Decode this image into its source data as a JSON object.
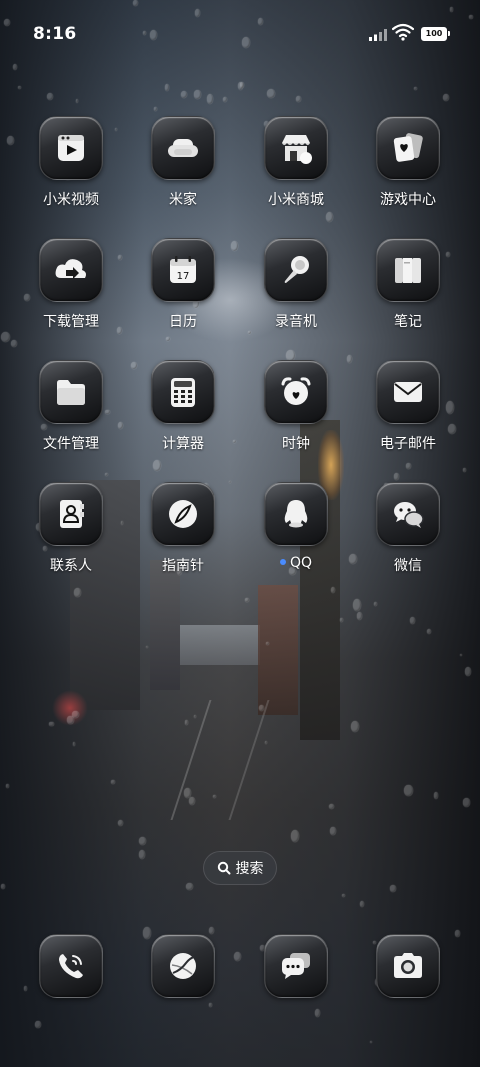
{
  "status_bar": {
    "time": "8:16",
    "battery": "100",
    "icons": [
      "signal-icon",
      "wifi-icon",
      "battery-icon"
    ]
  },
  "apps": [
    {
      "label": "小米视频",
      "icon": "video-player-icon"
    },
    {
      "label": "米家",
      "icon": "sofa-icon"
    },
    {
      "label": "小米商城",
      "icon": "store-icon"
    },
    {
      "label": "游戏中心",
      "icon": "playing-cards-icon"
    },
    {
      "label": "下载管理",
      "icon": "download-cloud-icon"
    },
    {
      "label": "日历",
      "icon": "calendar-icon",
      "badge_text": "17"
    },
    {
      "label": "录音机",
      "icon": "microphone-icon"
    },
    {
      "label": "笔记",
      "icon": "notebook-icon"
    },
    {
      "label": "文件管理",
      "icon": "folder-icon"
    },
    {
      "label": "计算器",
      "icon": "calculator-icon"
    },
    {
      "label": "时钟",
      "icon": "alarm-clock-icon"
    },
    {
      "label": "电子邮件",
      "icon": "envelope-icon"
    },
    {
      "label": "联系人",
      "icon": "contact-book-icon"
    },
    {
      "label": "指南针",
      "icon": "compass-icon"
    },
    {
      "label": "QQ",
      "icon": "penguin-icon",
      "new_dot": true
    },
    {
      "label": "微信",
      "icon": "chat-bubbles-icon"
    }
  ],
  "search": {
    "label": "搜索",
    "icon": "search-icon"
  },
  "dock": [
    {
      "name": "phone",
      "icon": "phone-icon"
    },
    {
      "name": "browser",
      "icon": "browser-globe-icon"
    },
    {
      "name": "messages",
      "icon": "messages-icon"
    },
    {
      "name": "camera",
      "icon": "camera-icon"
    }
  ],
  "colors": {
    "new_indicator": "#4a8cff",
    "icon_glass": "#2b2d31"
  }
}
